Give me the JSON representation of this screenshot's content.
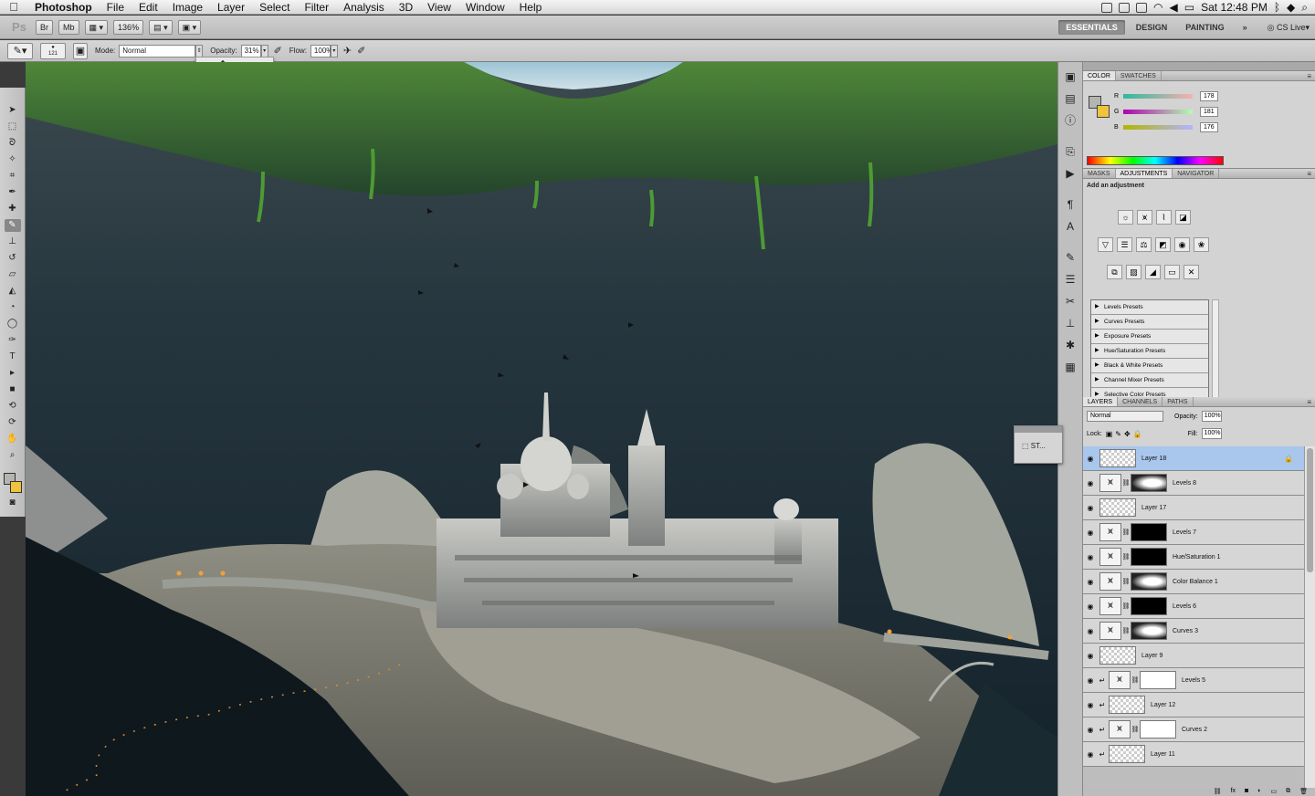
{
  "menubar": {
    "app_name": "Photoshop",
    "items": [
      "File",
      "Edit",
      "Image",
      "Layer",
      "Select",
      "Filter",
      "Analysis",
      "3D",
      "View",
      "Window",
      "Help"
    ],
    "clock": "Sat 12:48 PM"
  },
  "appbar": {
    "logo": "Ps",
    "bridge_label": "Br",
    "minibridge_label": "Mb",
    "zoom": "136%",
    "workspaces": [
      "ESSENTIALS",
      "DESIGN",
      "PAINTING"
    ],
    "more": "»",
    "cslive": "CS Live"
  },
  "options": {
    "brush_size": "121",
    "mode_label": "Mode:",
    "mode_value": "Normal",
    "opacity_label": "Opacity:",
    "opacity_value": "31%",
    "flow_label": "Flow:",
    "flow_value": "100%"
  },
  "floating_panel": {
    "label": "ST..."
  },
  "color_panel": {
    "tabs": [
      "COLOR",
      "SWATCHES"
    ],
    "channels": [
      {
        "name": "R",
        "value": "178"
      },
      {
        "name": "G",
        "value": "181"
      },
      {
        "name": "B",
        "value": "176"
      }
    ],
    "foreground": "#b2b5b0",
    "background": "#efc43c"
  },
  "adjustments_panel": {
    "tabs": [
      "MASKS",
      "ADJUSTMENTS",
      "NAVIGATOR"
    ],
    "title": "Add an adjustment",
    "presets": [
      "Levels Presets",
      "Curves Presets",
      "Exposure Presets",
      "Hue/Saturation Presets",
      "Black & White Presets",
      "Channel Mixer Presets",
      "Selective Color Presets"
    ]
  },
  "layers_panel": {
    "tabs": [
      "LAYERS",
      "CHANNELS",
      "PATHS"
    ],
    "blend_mode": "Normal",
    "opacity_label": "Opacity:",
    "opacity_value": "100%",
    "lock_label": "Lock:",
    "fill_label": "Fill:",
    "fill_value": "100%",
    "layers": [
      {
        "name": "Layer 18",
        "kind": "pixel",
        "selected": true
      },
      {
        "name": "Levels 8",
        "kind": "adjust",
        "mask": "mid"
      },
      {
        "name": "Layer 17",
        "kind": "pixel"
      },
      {
        "name": "Levels 7",
        "kind": "adjust",
        "mask": "black"
      },
      {
        "name": "Hue/Saturation 1",
        "kind": "adjust",
        "mask": "black"
      },
      {
        "name": "Color Balance 1",
        "kind": "adjust",
        "mask": "mid"
      },
      {
        "name": "Levels 6",
        "kind": "adjust",
        "mask": "black"
      },
      {
        "name": "Curves 3",
        "kind": "adjust",
        "mask": "mid"
      },
      {
        "name": "Layer 9",
        "kind": "pixel"
      },
      {
        "name": "Levels 5",
        "kind": "adjust",
        "mask": "white",
        "clipped": true
      },
      {
        "name": "Layer 12",
        "kind": "pixel",
        "clipped": true
      },
      {
        "name": "Curves 2",
        "kind": "adjust",
        "mask": "white",
        "clipped": true
      },
      {
        "name": "Layer 11",
        "kind": "pixel",
        "clipped": true
      }
    ]
  }
}
